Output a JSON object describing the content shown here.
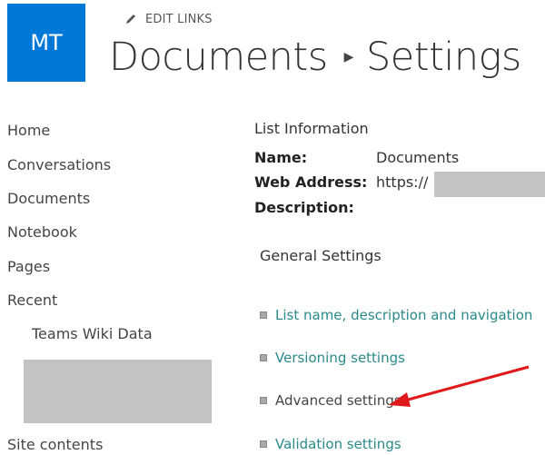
{
  "header": {
    "logo_initials": "MT",
    "logo_color": "#0078d7",
    "edit_links_label": "EDIT LINKS",
    "breadcrumb": [
      "Documents",
      "Settings"
    ],
    "breadcrumb_separator_icon": "triangle-right-icon"
  },
  "sidebar": {
    "items": [
      {
        "label": "Home"
      },
      {
        "label": "Conversations"
      },
      {
        "label": "Documents"
      },
      {
        "label": "Notebook"
      },
      {
        "label": "Pages"
      },
      {
        "label": "Recent"
      },
      {
        "label": "Teams Wiki Data"
      },
      {
        "label": "Site contents"
      }
    ]
  },
  "list_info": {
    "heading": "List Information",
    "name_label": "Name:",
    "name_value": "Documents",
    "web_address_label": "Web Address:",
    "web_address_value": "https://",
    "description_label": "Description:"
  },
  "general_settings": {
    "heading": "General Settings",
    "link_color": "#2a8a8a",
    "links": [
      {
        "label": "List name, description and navigation"
      },
      {
        "label": "Versioning settings"
      },
      {
        "label": "Advanced settings"
      },
      {
        "label": "Validation settings"
      }
    ]
  },
  "annotation": {
    "arrow_color": "#e0191b",
    "target": "Advanced settings"
  }
}
